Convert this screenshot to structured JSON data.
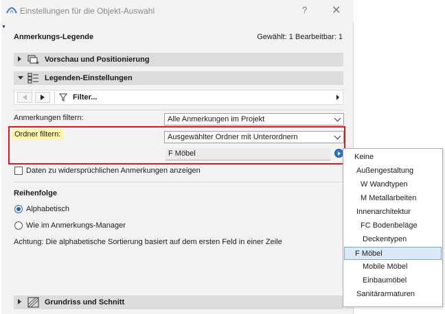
{
  "window": {
    "title": "Einstellungen für die Objekt-Auswahl",
    "help_glyph": "?",
    "close_glyph": "✕",
    "corner_glyph": "▼"
  },
  "header": {
    "label": "Anmerkungs-Legende",
    "status": "Gewählt: 1 Bearbeitbar: 1"
  },
  "sections": {
    "preview": "Vorschau und Positionierung",
    "legend": "Legenden-Einstellungen",
    "floorplan": "Grundriss und Schnitt"
  },
  "filterbar": {
    "label": "Filter..."
  },
  "filters": {
    "annotations_label": "Anmerkungen filtern:",
    "annotations_value": "Alle Anmerkungen im Projekt",
    "folder_label": "Ordner filtern:",
    "folder_value": "Ausgewählter Ordner mit Unterordnern",
    "folder_selected": "F Möbel"
  },
  "options": {
    "conflict_checkbox": "Daten zu widersprüchlichen Anmerkungen anzeigen",
    "conflict_checked": false
  },
  "order": {
    "heading": "Reihenfolge",
    "alphabetical": "Alphabetisch",
    "manager": "Wie im Anmerkungs-Manager",
    "selected": "alphabetical",
    "note": "Achtung: Die alphabetische Sortierung basiert auf dem ersten Feld in einer Zeile"
  },
  "popup": {
    "items": [
      {
        "label": "Keine",
        "level": 0
      },
      {
        "label": "Außengestaltung",
        "level": 1
      },
      {
        "label": "W Wandtypen",
        "level": 2
      },
      {
        "label": "M Metallarbeiten",
        "level": 2
      },
      {
        "label": "Innenarchitektur",
        "level": 1
      },
      {
        "label": "FC Bodenbeläge",
        "level": 2
      },
      {
        "label": "Deckentypen",
        "level": 3
      },
      {
        "label": "F Möbel",
        "level": 0,
        "selected": true
      },
      {
        "label": "Mobile Möbel",
        "level": 3
      },
      {
        "label": "Einbaumöbel",
        "level": 3
      },
      {
        "label": "Sanitärarmaturen",
        "level": 1
      }
    ]
  },
  "colors": {
    "highlight_border": "#e0141e",
    "label_highlight": "#fff5a8",
    "accent": "#1f5fb8"
  }
}
